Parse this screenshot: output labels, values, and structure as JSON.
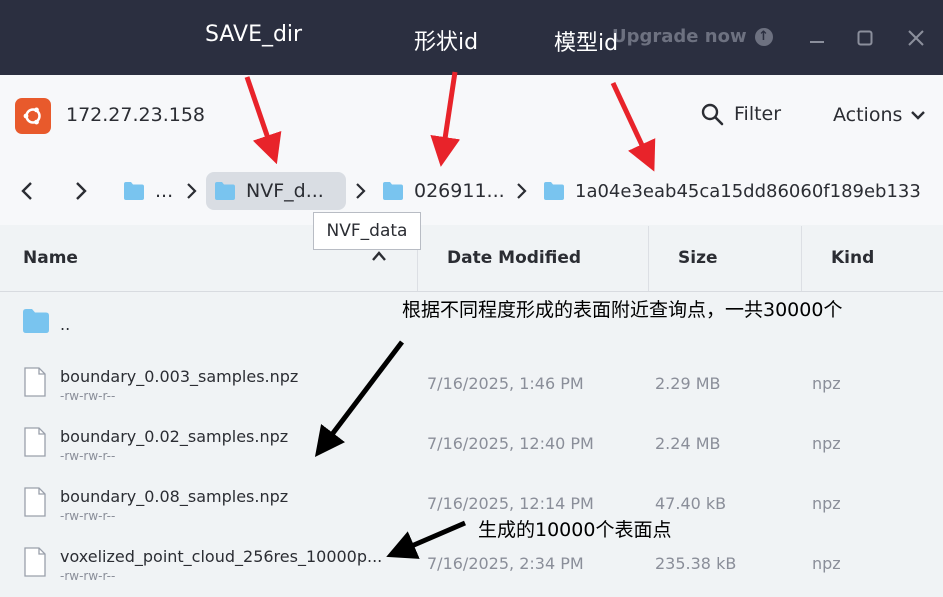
{
  "titlebar": {
    "upgrade_label": "Upgrade now"
  },
  "annotations": {
    "save_dir": "SAVE_dir",
    "shape_id": "形状id",
    "model_id": "模型id",
    "near_surface_note": "根据不同程度形成的表面附近查询点，一共30000个",
    "surface_points_note": "生成的10000个表面点"
  },
  "header": {
    "host": "172.27.23.158",
    "filter_label": "Filter",
    "actions_label": "Actions"
  },
  "breadcrumb": {
    "ellipsis_label": "...",
    "items": [
      {
        "label": "NVF_d..."
      },
      {
        "label": "026911..."
      },
      {
        "label": "1a04e3eab45ca15dd86060f189eb133"
      }
    ],
    "tooltip": "NVF_data"
  },
  "table": {
    "columns": {
      "name": "Name",
      "date": "Date Modified",
      "size": "Size",
      "kind": "Kind"
    },
    "parent_label": "..",
    "rows": [
      {
        "name": "boundary_0.003_samples.npz",
        "perm": "-rw-rw-r--",
        "date": "7/16/2025, 1:46 PM",
        "size": "2.29 MB",
        "kind": "npz"
      },
      {
        "name": "boundary_0.02_samples.npz",
        "perm": "-rw-rw-r--",
        "date": "7/16/2025, 12:40 PM",
        "size": "2.24 MB",
        "kind": "npz"
      },
      {
        "name": "boundary_0.08_samples.npz",
        "perm": "-rw-rw-r--",
        "date": "7/16/2025, 12:14 PM",
        "size": "47.40 kB",
        "kind": "npz"
      },
      {
        "name": "voxelized_point_cloud_256res_10000p...",
        "perm": "-rw-rw-r--",
        "date": "7/16/2025, 2:34 PM",
        "size": "235.38 kB",
        "kind": "npz"
      }
    ]
  },
  "colors": {
    "titlebar_bg": "#2b2f40",
    "logo_bg": "#e85a2c",
    "folder_blue": "#79c4ef",
    "annotation_arrow_red": "#e8232a",
    "annotation_arrow_black": "#000000"
  },
  "icons": [
    "upgrade-icon",
    "minimize-icon",
    "maximize-icon",
    "close-icon",
    "ubuntu-logo-icon",
    "search-icon",
    "chevron-down-icon",
    "back-icon",
    "forward-icon",
    "folder-icon",
    "chevron-right-icon",
    "sort-up-icon",
    "file-icon"
  ]
}
